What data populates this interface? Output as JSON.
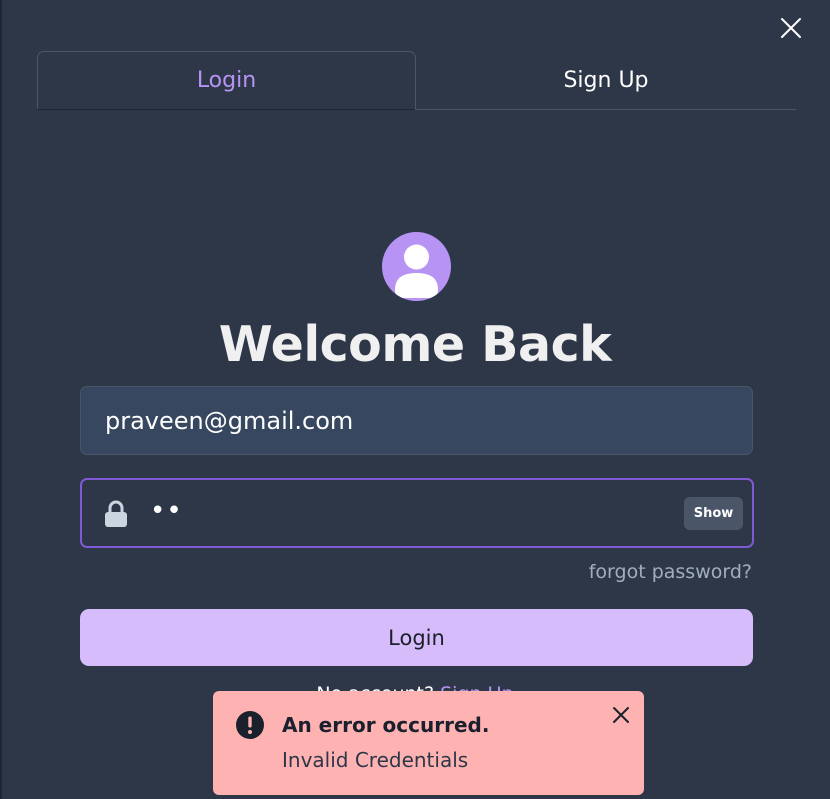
{
  "tabs": [
    {
      "label": "Login",
      "active": true
    },
    {
      "label": "Sign Up",
      "active": false
    }
  ],
  "form": {
    "title": "Welcome Back",
    "email_value": "praveen@gmail.com",
    "password_value": "••",
    "show_label": "Show",
    "forgot_label": "forgot password?",
    "login_label": "Login",
    "signup_prompt": "No account?",
    "signup_link": "Sign Up"
  },
  "toast": {
    "title": "An error occurred.",
    "description": "Invalid Credentials",
    "status": "error"
  },
  "icons": {
    "close": "close-icon",
    "avatar": "user-avatar-icon",
    "lock": "lock-icon",
    "error": "warning-circle-icon",
    "toast_close": "close-icon"
  },
  "colors": {
    "background": "#2d3748",
    "accent": "#b794f4",
    "focus_border": "#805ad5",
    "button": "#d6bcfa",
    "toast_bg": "#feb2b2"
  }
}
